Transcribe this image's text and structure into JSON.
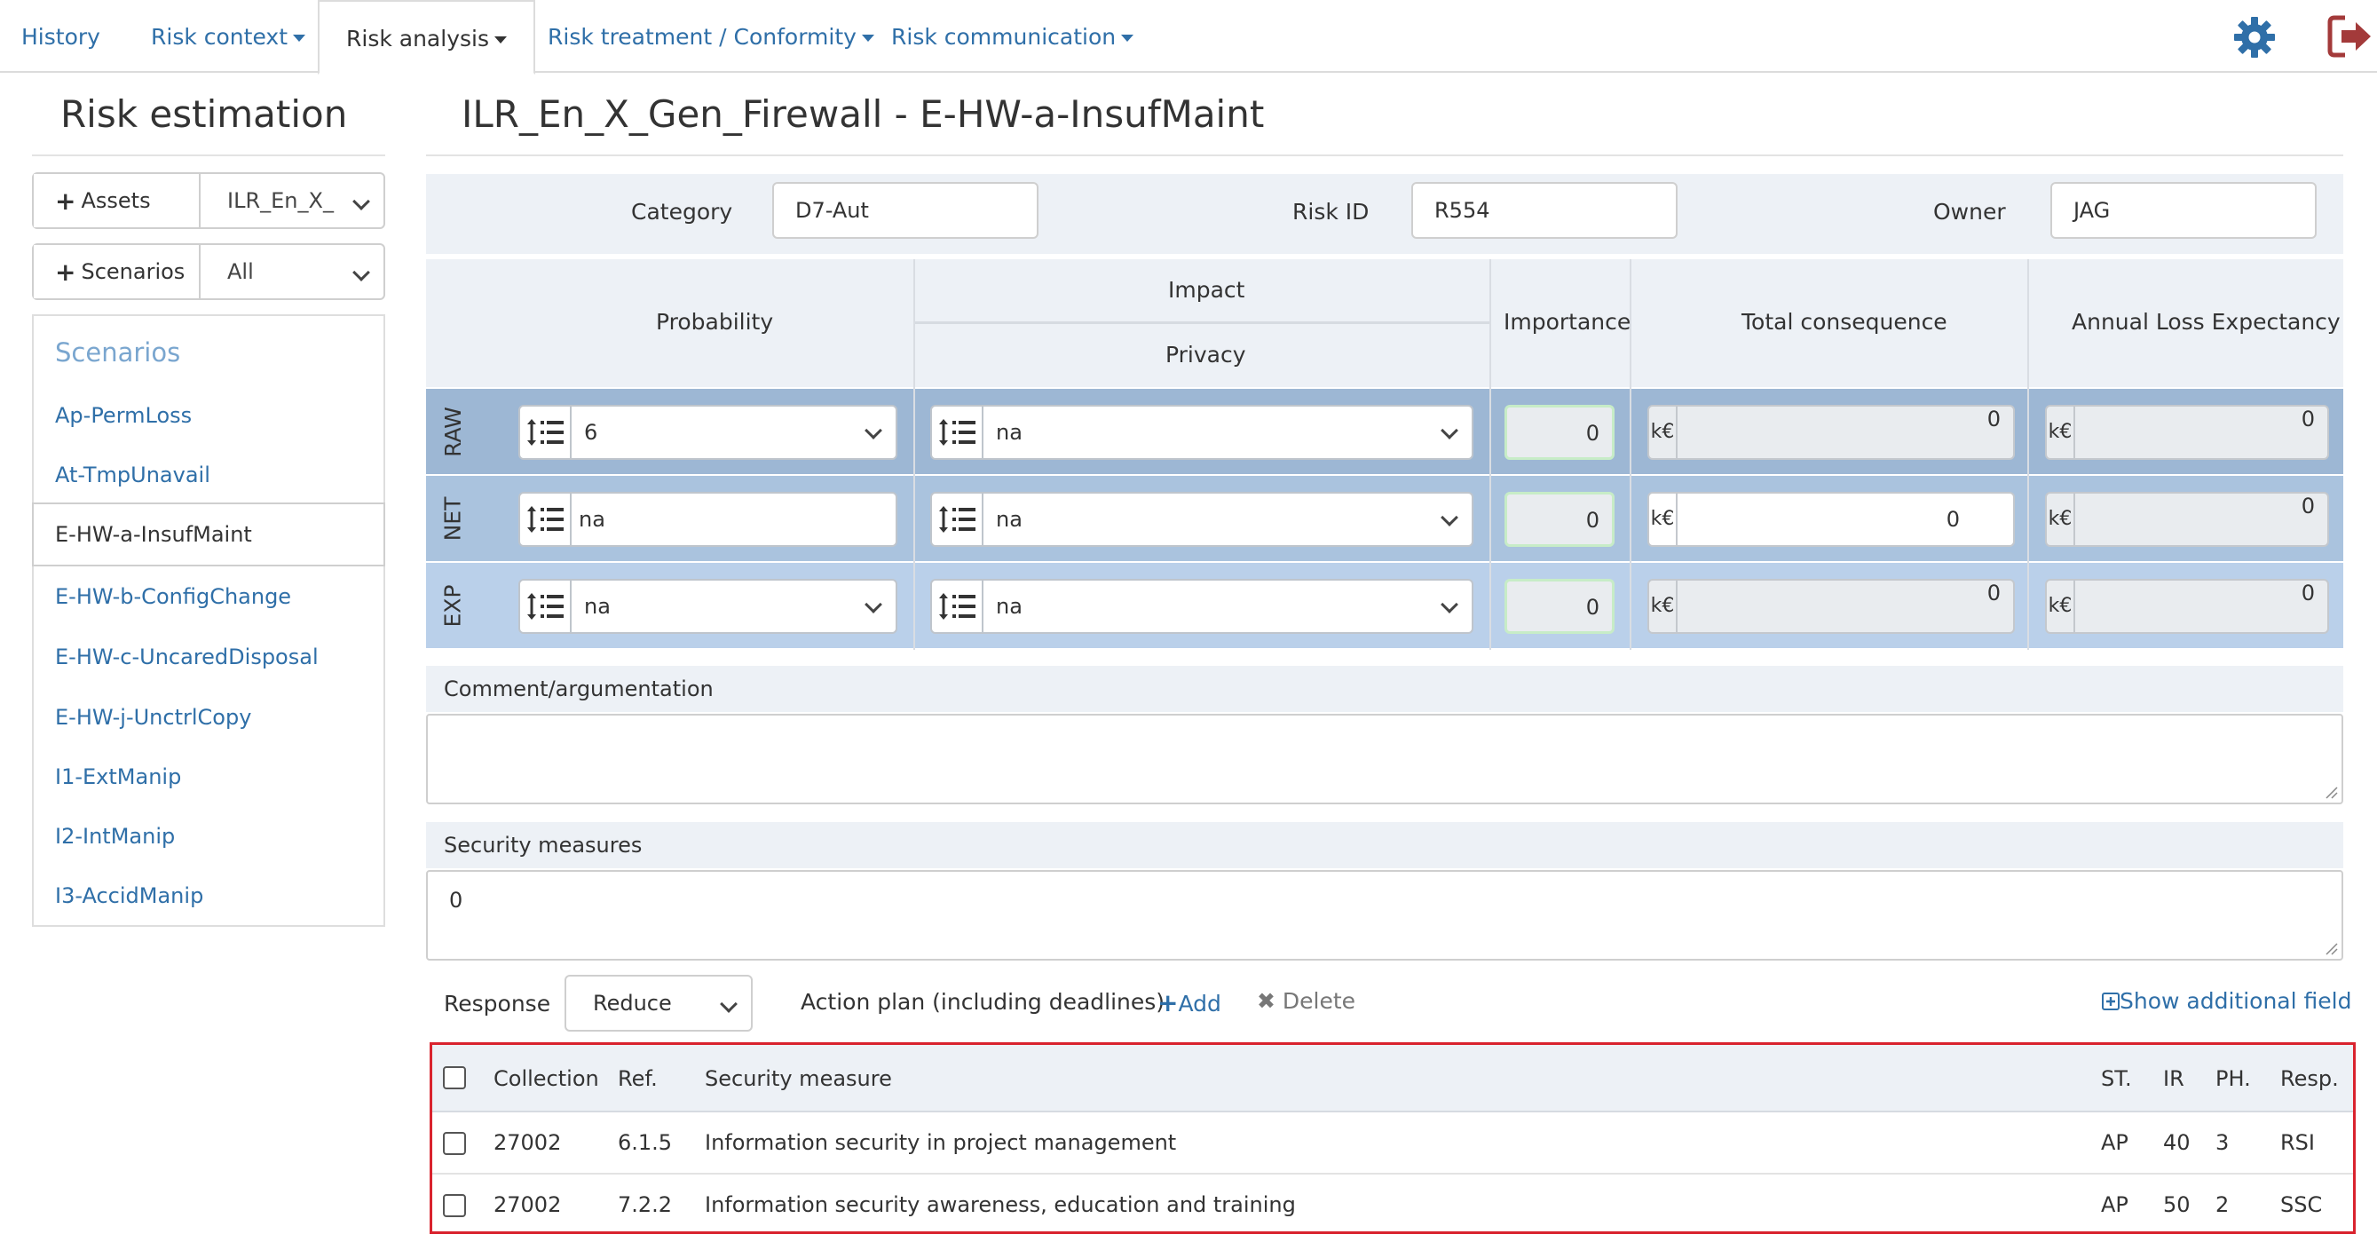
{
  "nav": {
    "tabs": [
      {
        "label": "History",
        "dropdown": false
      },
      {
        "label": "Risk context",
        "dropdown": true
      },
      {
        "label": "Risk analysis",
        "dropdown": true,
        "active": true
      },
      {
        "label": "Risk treatment / Conformity",
        "dropdown": true
      },
      {
        "label": "Risk communication",
        "dropdown": true
      }
    ],
    "settings_icon": "gear-icon",
    "logout_icon": "logout-icon"
  },
  "sidebar": {
    "title": "Risk estimation",
    "assets_button": "Assets",
    "assets_value": "ILR_En_X_",
    "scenarios_button": "Scenarios",
    "scenarios_value": "All",
    "list_heading": "Scenarios",
    "items": [
      {
        "label": "Ap-PermLoss"
      },
      {
        "label": "At-TmpUnavail"
      },
      {
        "label": "E-HW-a-InsufMaint",
        "active": true
      },
      {
        "label": "E-HW-b-ConfigChange"
      },
      {
        "label": "E-HW-c-UncaredDisposal"
      },
      {
        "label": "E-HW-j-UnctrlCopy"
      },
      {
        "label": "I1-ExtManip"
      },
      {
        "label": "I2-IntManip"
      },
      {
        "label": "I3-AccidManip"
      }
    ]
  },
  "main": {
    "title": "ILR_En_X_Gen_Firewall - E-HW-a-InsufMaint",
    "category_label": "Category",
    "category_value": "D7-Aut",
    "riskid_label": "Risk ID",
    "riskid_value": "R554",
    "owner_label": "Owner",
    "owner_value": "JAG"
  },
  "grid": {
    "headers": {
      "probability": "Probability",
      "impact": "Impact",
      "privacy": "Privacy",
      "importance": "Importance",
      "total_consequence": "Total consequence",
      "ale": "Annual Loss Expectancy"
    },
    "currency": "k€",
    "rows": [
      {
        "label": "RAW",
        "probability": "6",
        "privacy": "na",
        "importance": "0",
        "consequence": "0",
        "ale": "0"
      },
      {
        "label": "NET",
        "probability": "na",
        "privacy": "na",
        "importance": "0",
        "consequence": "0",
        "ale": "0"
      },
      {
        "label": "EXP",
        "probability": "na",
        "privacy": "na",
        "importance": "0",
        "consequence": "0",
        "ale": "0"
      }
    ],
    "colors": {
      "raw": "#9db7d4",
      "net": "#aac3de",
      "exp": "#bad0ea"
    }
  },
  "comment": {
    "label": "Comment/argumentation",
    "value": ""
  },
  "security": {
    "label": "Security measures",
    "value": "0"
  },
  "response": {
    "label": "Response",
    "value": "Reduce",
    "action_plan_label": "Action plan (including deadlines)",
    "add_label": "Add",
    "delete_label": "Delete",
    "show_additional": "Show additional field"
  },
  "measures_table": {
    "columns": [
      "Collection",
      "Ref.",
      "Security measure",
      "ST.",
      "IR",
      "PH.",
      "Resp."
    ],
    "rows": [
      {
        "collection": "27002",
        "ref": "6.1.5",
        "measure": "Information security in project management",
        "st": "AP",
        "ir": "40",
        "ph": "3",
        "resp": "RSI"
      },
      {
        "collection": "27002",
        "ref": "7.2.2",
        "measure": "Information security awareness, education and training",
        "st": "AP",
        "ir": "50",
        "ph": "2",
        "resp": "SSC"
      }
    ]
  }
}
